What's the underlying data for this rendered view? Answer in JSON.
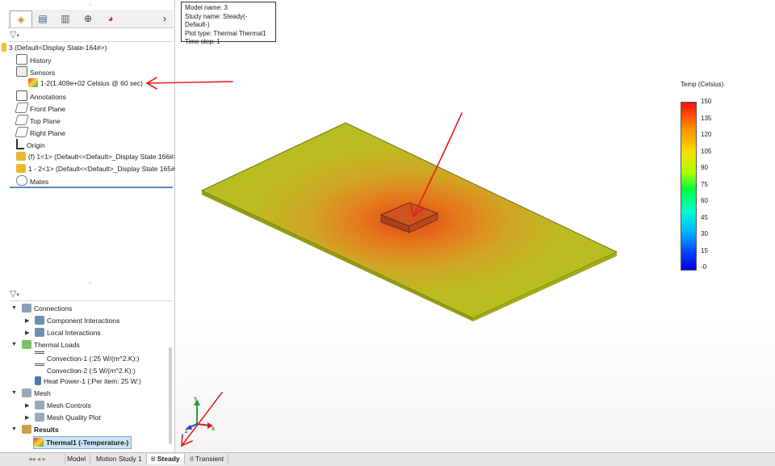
{
  "feature_tree": {
    "root": "3  (Default<Display State-164#>)",
    "items": [
      {
        "label": "History"
      },
      {
        "label": "Sensors"
      },
      {
        "label": "1-2(1.409e+02 Celsius @ 60 sec)"
      },
      {
        "label": "Annotations"
      },
      {
        "label": "Front Plane"
      },
      {
        "label": "Top Plane"
      },
      {
        "label": "Right Plane"
      },
      {
        "label": "Origin"
      },
      {
        "label": "(f) 1<1> (Default<<Default>_Display State 166#>)"
      },
      {
        "label": "1 - 2<1> (Default<<Default>_Display State 165#>)"
      },
      {
        "label": "Mates"
      }
    ]
  },
  "study_tree": {
    "items": [
      {
        "label": "Connections"
      },
      {
        "label": "Component Interactions"
      },
      {
        "label": "Local Interactions"
      },
      {
        "label": "Thermal Loads"
      },
      {
        "label": "Convection-1 (:25 W/(m^2.K):)"
      },
      {
        "label": "Convection-2 (:5 W/(m^2.K):)"
      },
      {
        "label": "Heat Power-1 (:Per item: 25 W:)"
      },
      {
        "label": "Mesh"
      },
      {
        "label": "Mesh Controls"
      },
      {
        "label": "Mesh Quality Plot"
      },
      {
        "label": "Results"
      },
      {
        "label": "Thermal1 (-Temperature-)"
      }
    ]
  },
  "info": {
    "model": "Model name: 3",
    "study": "Study name: Steady(-Default-)",
    "plot": "Plot type: Thermal Thermal1",
    "step": "Time step: 1"
  },
  "legend": {
    "title": "Temp (Celsius)",
    "ticks": [
      "150",
      "135",
      "120",
      "105",
      "90",
      "75",
      "60",
      "45",
      "30",
      "15",
      "-0"
    ]
  },
  "bottom_tabs": [
    "Model",
    "Motion Study 1",
    "Steady",
    "Transient"
  ],
  "colors": {
    "annotation_arrow": "#e02020",
    "accent": "#5b87c7"
  }
}
